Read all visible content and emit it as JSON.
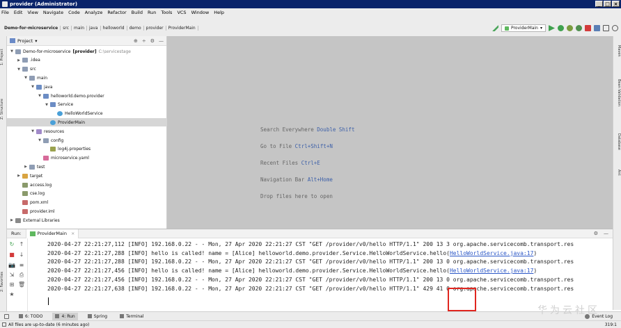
{
  "window": {
    "title": "provider (Administrator)",
    "controls": [
      "_",
      "□",
      "×"
    ]
  },
  "menu": [
    "File",
    "Edit",
    "View",
    "Navigate",
    "Code",
    "Analyze",
    "Refactor",
    "Build",
    "Run",
    "Tools",
    "VCS",
    "Window",
    "Help"
  ],
  "breadcrumb": [
    "Demo-for-microservice",
    "src",
    "main",
    "java",
    "helloworld",
    "demo",
    "provider",
    "ProviderMain"
  ],
  "toolbar": {
    "run_config": "ProviderMain",
    "dropdown_arrow": "▾"
  },
  "project_panel": {
    "title": "Project",
    "title_arrow": "▾",
    "header_buttons": [
      "⊕",
      "÷",
      "⚙",
      "—"
    ],
    "tree": [
      {
        "depth": 0,
        "arrow": "▼",
        "icon": "folder",
        "label": "Demo-for-microservice",
        "bold": "[provider]",
        "suffix": "C:\\servicestage"
      },
      {
        "depth": 1,
        "arrow": "▶",
        "icon": "folder",
        "label": ".idea"
      },
      {
        "depth": 1,
        "arrow": "▼",
        "icon": "folder",
        "label": "src"
      },
      {
        "depth": 2,
        "arrow": "▼",
        "icon": "folder",
        "label": "main"
      },
      {
        "depth": 3,
        "arrow": "▼",
        "icon": "folder-src",
        "label": "java"
      },
      {
        "depth": 4,
        "arrow": "▼",
        "icon": "folder-src",
        "label": "helloworld.demo.provider"
      },
      {
        "depth": 5,
        "arrow": "▼",
        "icon": "folder-src",
        "label": "Service"
      },
      {
        "depth": 6,
        "arrow": "",
        "icon": "cls",
        "label": "HelloWorldService"
      },
      {
        "depth": 5,
        "arrow": "",
        "icon": "cls",
        "label": "ProviderMain",
        "selected": true
      },
      {
        "depth": 3,
        "arrow": "▼",
        "icon": "folder-res",
        "label": "resources"
      },
      {
        "depth": 4,
        "arrow": "▼",
        "icon": "folder",
        "label": "config"
      },
      {
        "depth": 5,
        "arrow": "",
        "icon": "file-prop",
        "label": "log4j.properties"
      },
      {
        "depth": 4,
        "arrow": "",
        "icon": "file-yaml",
        "label": "microservice.yaml"
      },
      {
        "depth": 2,
        "arrow": "▶",
        "icon": "folder",
        "label": "test"
      },
      {
        "depth": 1,
        "arrow": "▶",
        "icon": "folder-target",
        "label": "target"
      },
      {
        "depth": 1,
        "arrow": "",
        "icon": "file-log",
        "label": "access.log"
      },
      {
        "depth": 1,
        "arrow": "",
        "icon": "file-log",
        "label": "cse.log"
      },
      {
        "depth": 1,
        "arrow": "",
        "icon": "file-xml",
        "label": "pom.xml"
      },
      {
        "depth": 1,
        "arrow": "",
        "icon": "file-xml",
        "label": "provider.iml"
      },
      {
        "depth": 0,
        "arrow": "▶",
        "icon": "lib",
        "label": "External Libraries"
      }
    ]
  },
  "left_tabs": [
    "1: Project",
    "Z: Structure",
    "2: Favorites"
  ],
  "right_tabs": [
    "Maven",
    "Bean Validation",
    "Database",
    "Ant"
  ],
  "editor_hints": [
    {
      "text": "Search Everywhere",
      "key": "Double Shift"
    },
    {
      "text": "Go to File",
      "key": "Ctrl+Shift+N"
    },
    {
      "text": "Recent Files",
      "key": "Ctrl+E"
    },
    {
      "text": "Navigation Bar",
      "key": "Alt+Home"
    },
    {
      "text": "Drop files here to open",
      "key": ""
    }
  ],
  "run_panel": {
    "label": "Run:",
    "tab": "ProviderMain",
    "close": "×",
    "header_buttons": [
      "⚙",
      "—"
    ],
    "side_buttons": [
      "↻",
      "↑",
      "■",
      "↓",
      "📷",
      "≡",
      "⇲",
      "⎙",
      "⊞",
      "🗑",
      "★"
    ],
    "lines": [
      {
        "pre": "2020-04-27 22:21:27,112 [INFO] 192.168.0.22 - - Mon, 27 Apr 2020 22:21:27 CST \"GET /provider/v0/hello HTTP/1.1\" 200 13 3 org.apache.servicecomb.transport.res",
        "link": "",
        "post": ""
      },
      {
        "pre": "2020-04-27 22:21:27,288 [INFO] hello is called! name = [Alice] helloworld.demo.provider.Service.HelloWorldService.hello(",
        "link": "HelloWorldService.java:17",
        "post": ")"
      },
      {
        "pre": "2020-04-27 22:21:27,288 [INFO] 192.168.0.22 - - Mon, 27 Apr 2020 22:21:27 CST \"GET /provider/v0/hello HTTP/1.1\" 200 13 0 org.apache.servicecomb.transport.res",
        "link": "",
        "post": ""
      },
      {
        "pre": "2020-04-27 22:21:27,456 [INFO] hello is called! name = [Alice] helloworld.demo.provider.Service.HelloWorldService.hello(",
        "link": "HelloWorldService.java:17",
        "post": ")"
      },
      {
        "pre": "2020-04-27 22:21:27,456 [INFO] 192.168.0.22 - - Mon, 27 Apr 2020 22:21:27 CST \"GET /provider/v0/hello HTTP/1.1\" 200 13 0 org.apache.servicecomb.transport.res",
        "link": "",
        "post": ""
      },
      {
        "pre": "2020-04-27 22:21:27,638 [INFO] 192.168.0.22 - - Mon, 27 Apr 2020 22:21:27 CST \"GET /provider/v0/hello HTTP/1.1\" 429 41 0 org.apache.servicecomb.transport.res",
        "link": "",
        "post": ""
      }
    ]
  },
  "bottom_tabs": [
    {
      "label": "6: TODO",
      "active": false
    },
    {
      "label": "4: Run",
      "active": true
    },
    {
      "label": "Spring",
      "active": false
    },
    {
      "label": "Terminal",
      "active": false
    }
  ],
  "event_log": "Event Log",
  "status": {
    "message": "All files are up-to-date (6 minutes ago)",
    "position": "319:1"
  },
  "watermark": "华为云社区",
  "colors": {
    "title_bar": "#0a246a",
    "highlight_box": "#e0261f",
    "link": "#2a56c6"
  }
}
